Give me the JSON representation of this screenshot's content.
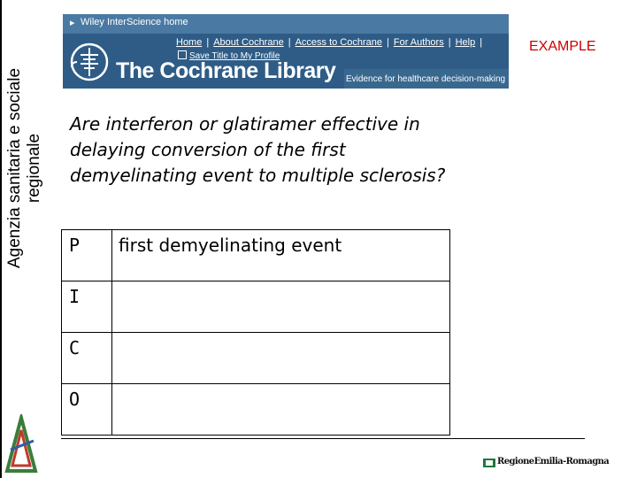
{
  "sidebar": {
    "line1": "Agenzia sanitaria e sociale",
    "line2": "regionale"
  },
  "banner": {
    "home_link": "Wiley InterScience home",
    "nav": [
      "Home",
      "About Cochrane",
      "Access to Cochrane",
      "For Authors",
      "Help"
    ],
    "save_title": "Save Title to My Profile",
    "library_name": "The Cochrane Library",
    "tagline": "Evidence for healthcare decision-making"
  },
  "label": "EXAMPLE",
  "question": "Are interferon or glatiramer effective in delaying conversion of the first demyelinating event to multiple sclerosis?",
  "pico": [
    {
      "letter": "P",
      "value": "first demyelinating event"
    },
    {
      "letter": "I",
      "value": ""
    },
    {
      "letter": "C",
      "value": ""
    },
    {
      "letter": "O",
      "value": ""
    }
  ],
  "footer": {
    "region_logo": "RegioneEmilia-Romagna"
  },
  "colors": {
    "banner_blue": "#2e5c86",
    "example_red": "#cc0000"
  }
}
